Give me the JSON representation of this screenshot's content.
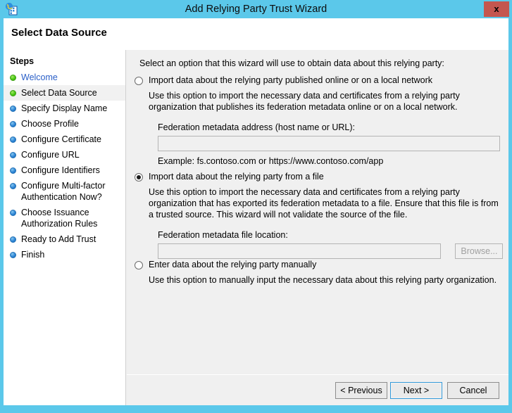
{
  "window": {
    "title": "Add Relying Party Trust Wizard",
    "icon": "wizard-globe-icon",
    "close_label": "x",
    "accent_color": "#5bc8ea"
  },
  "page": {
    "title": "Select Data Source"
  },
  "sidebar": {
    "header": "Steps",
    "items": [
      {
        "label": "Welcome",
        "state": "done",
        "style": "link",
        "current": false
      },
      {
        "label": "Select Data Source",
        "state": "done",
        "style": "plain",
        "current": true
      },
      {
        "label": "Specify Display Name",
        "state": "todo",
        "style": "plain",
        "current": false
      },
      {
        "label": "Choose Profile",
        "state": "todo",
        "style": "plain",
        "current": false
      },
      {
        "label": "Configure Certificate",
        "state": "todo",
        "style": "plain",
        "current": false
      },
      {
        "label": "Configure URL",
        "state": "todo",
        "style": "plain",
        "current": false
      },
      {
        "label": "Configure Identifiers",
        "state": "todo",
        "style": "plain",
        "current": false
      },
      {
        "label": "Configure Multi-factor Authentication Now?",
        "state": "todo",
        "style": "plain",
        "current": false
      },
      {
        "label": "Choose Issuance Authorization Rules",
        "state": "todo",
        "style": "plain",
        "current": false
      },
      {
        "label": "Ready to Add Trust",
        "state": "todo",
        "style": "plain",
        "current": false
      },
      {
        "label": "Finish",
        "state": "todo",
        "style": "plain",
        "current": false
      }
    ]
  },
  "content": {
    "intro": "Select an option that this wizard will use to obtain data about this relying party:",
    "options": [
      {
        "id": "online",
        "label": "Import data about the relying party published online or on a local network",
        "selected": false,
        "description": "Use this option to import the necessary data and certificates from a relying party organization that publishes its federation metadata online or on a local network.",
        "field_label": "Federation metadata address (host name or URL):",
        "field_value": "",
        "example": "Example: fs.contoso.com or https://www.contoso.com/app"
      },
      {
        "id": "file",
        "label": "Import data about the relying party from a file",
        "selected": true,
        "description": "Use this option to import the necessary data and certificates from a relying party organization that has exported its federation metadata to a file. Ensure that this file is from a trusted source.  This wizard will not validate the source of the file.",
        "field_label": "Federation metadata file location:",
        "field_value": "",
        "browse_label": "Browse..."
      },
      {
        "id": "manual",
        "label": "Enter data about the relying party manually",
        "selected": false,
        "description": "Use this option to manually input the necessary data about this relying party organization."
      }
    ]
  },
  "footer": {
    "previous_label": "< Previous",
    "next_label": "Next >",
    "cancel_label": "Cancel"
  }
}
